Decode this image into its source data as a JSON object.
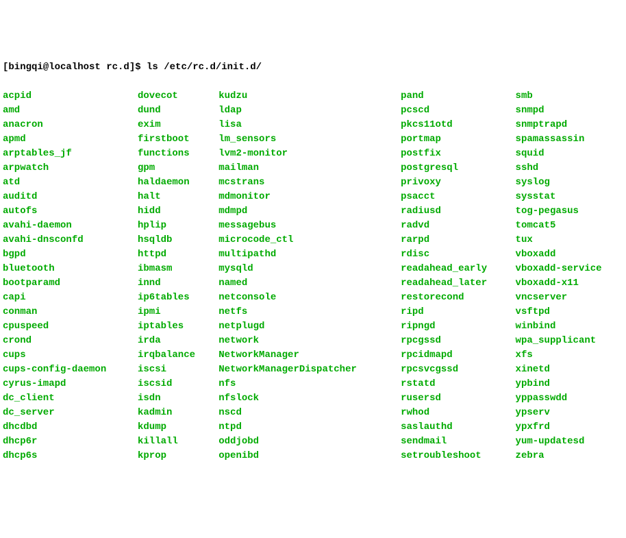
{
  "prompt": "[bingqi@localhost rc.d]$ ls /etc/rc.d/init.d/",
  "columns": {
    "c1": [
      "acpid",
      "amd",
      "anacron",
      "apmd",
      "arptables_jf",
      "arpwatch",
      "atd",
      "auditd",
      "autofs",
      "avahi-daemon",
      "avahi-dnsconfd",
      "bgpd",
      "bluetooth",
      "bootparamd",
      "capi",
      "conman",
      "cpuspeed",
      "crond",
      "cups",
      "cups-config-daemon",
      "cyrus-imapd",
      "dc_client",
      "dc_server",
      "dhcdbd",
      "dhcp6r",
      "dhcp6s"
    ],
    "c2": [
      "dovecot",
      "dund",
      "exim",
      "firstboot",
      "functions",
      "gpm",
      "haldaemon",
      "halt",
      "hidd",
      "hplip",
      "hsqldb",
      "httpd",
      "ibmasm",
      "innd",
      "ip6tables",
      "ipmi",
      "iptables",
      "irda",
      "irqbalance",
      "iscsi",
      "iscsid",
      "isdn",
      "kadmin",
      "kdump",
      "killall",
      "kprop"
    ],
    "c3": [
      "kudzu",
      "ldap",
      "lisa",
      "lm_sensors",
      "lvm2-monitor",
      "mailman",
      "mcstrans",
      "mdmonitor",
      "mdmpd",
      "messagebus",
      "microcode_ctl",
      "multipathd",
      "mysqld",
      "named",
      "netconsole",
      "netfs",
      "netplugd",
      "network",
      "NetworkManager",
      "NetworkManagerDispatcher",
      "nfs",
      "nfslock",
      "nscd",
      "ntpd",
      "oddjobd",
      "openibd"
    ],
    "c4": [
      "pand",
      "pcscd",
      "pkcs11otd",
      "portmap",
      "postfix",
      "postgresql",
      "privoxy",
      "psacct",
      "radiusd",
      "radvd",
      "rarpd",
      "rdisc",
      "readahead_early",
      "readahead_later",
      "restorecond",
      "ripd",
      "ripngd",
      "rpcgssd",
      "rpcidmapd",
      "rpcsvcgssd",
      "rstatd",
      "rusersd",
      "rwhod",
      "saslauthd",
      "sendmail",
      "setroubleshoot"
    ],
    "c5": [
      "smb",
      "snmpd",
      "snmptrapd",
      "spamassassin",
      "squid",
      "sshd",
      "syslog",
      "sysstat",
      "tog-pegasus",
      "tomcat5",
      "tux",
      "vboxadd",
      "vboxadd-service",
      "vboxadd-x11",
      "vncserver",
      "vsftpd",
      "winbind",
      "wpa_supplicant",
      "xfs",
      "xinetd",
      "ypbind",
      "yppasswdd",
      "ypserv",
      "ypxfrd",
      "yum-updatesd",
      "zebra"
    ]
  }
}
